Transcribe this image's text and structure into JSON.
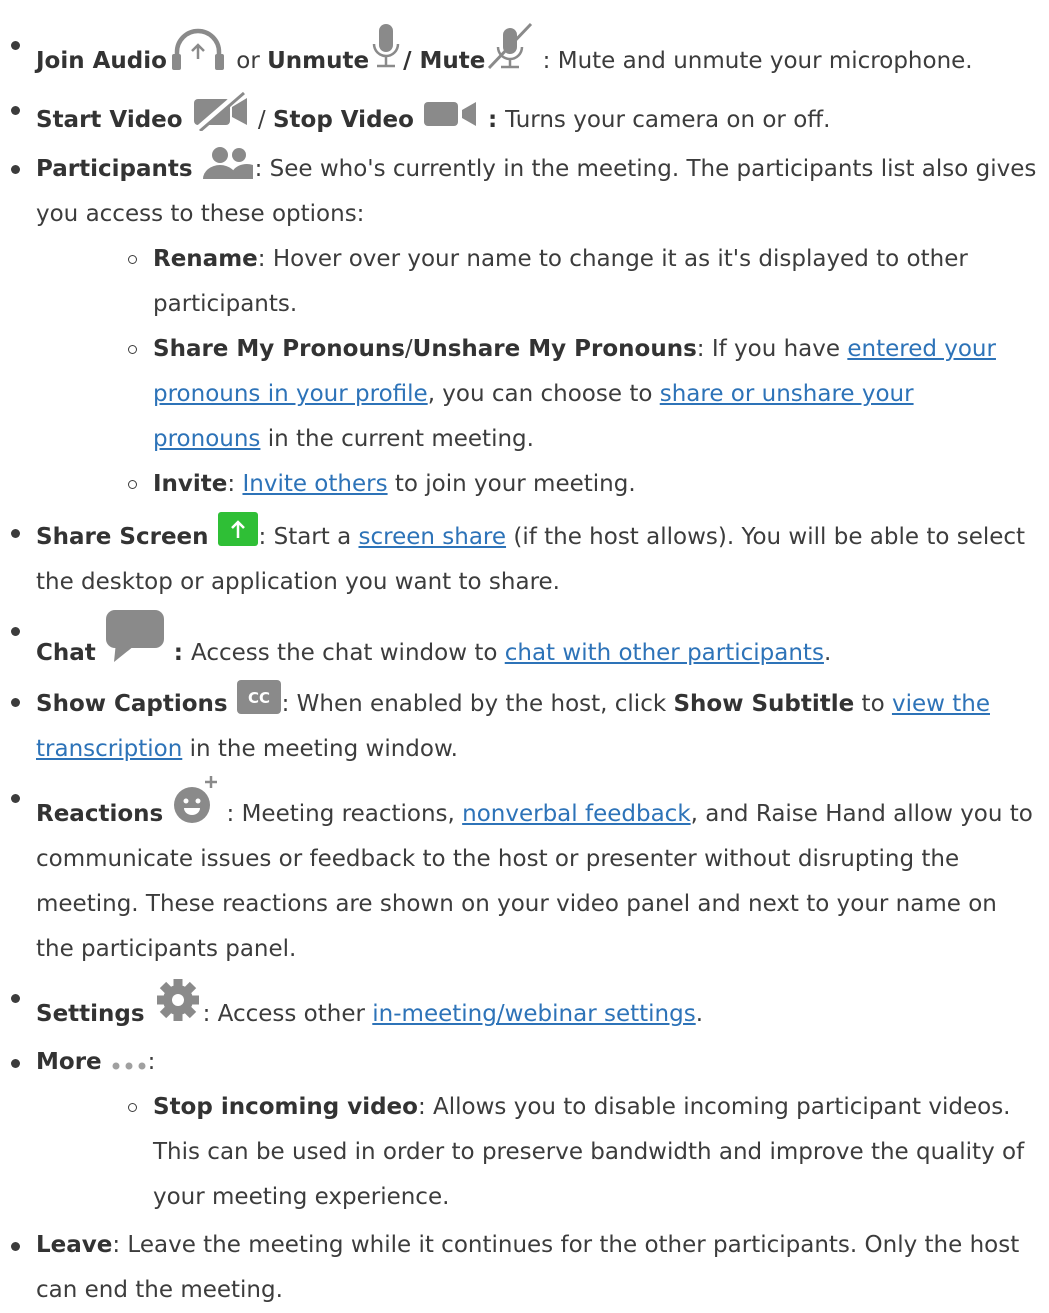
{
  "items": [
    {
      "parts": [
        {
          "t": "b",
          "v": "Join Audio"
        },
        {
          "t": "icon",
          "name": "headphones-arrow-icon"
        },
        {
          "t": "x",
          "v": " or "
        },
        {
          "t": "b",
          "v": "Unmute"
        },
        {
          "t": "icon",
          "name": "microphone-icon"
        },
        {
          "t": "b",
          "v": "/ Mute"
        },
        {
          "t": "icon",
          "name": "microphone-muted-icon"
        },
        {
          "t": "x",
          "v": " : Mute and unmute your microphone."
        }
      ]
    },
    {
      "parts": [
        {
          "t": "b",
          "v": "Start Video "
        },
        {
          "t": "icon",
          "name": "video-off-icon"
        },
        {
          "t": "x",
          "v": " / "
        },
        {
          "t": "b",
          "v": "Stop Video "
        },
        {
          "t": "icon",
          "name": "video-camera-icon"
        },
        {
          "t": "b",
          "v": " : "
        },
        {
          "t": "x",
          "v": "Turns your camera on or off."
        }
      ]
    },
    {
      "parts": [
        {
          "t": "b",
          "v": "Participants "
        },
        {
          "t": "icon",
          "name": "participants-icon"
        },
        {
          "t": "x",
          "v": ": See who's currently in the meeting. The participants list also gives you access to these options:"
        }
      ],
      "sub": [
        {
          "parts": [
            {
              "t": "b",
              "v": "Rename"
            },
            {
              "t": "x",
              "v": ": Hover over your name to change it as it's displayed to other participants."
            }
          ]
        },
        {
          "parts": [
            {
              "t": "b",
              "v": "Share My Pronouns"
            },
            {
              "t": "x",
              "v": "/"
            },
            {
              "t": "b",
              "v": "Unshare My Pronouns"
            },
            {
              "t": "x",
              "v": ": If you have "
            },
            {
              "t": "a",
              "v": "entered your pronouns in your profile"
            },
            {
              "t": "x",
              "v": ", you can choose to "
            },
            {
              "t": "a",
              "v": "share or unshare your pronouns"
            },
            {
              "t": "x",
              "v": " in the current meeting."
            }
          ]
        },
        {
          "parts": [
            {
              "t": "b",
              "v": "Invite"
            },
            {
              "t": "x",
              "v": ": "
            },
            {
              "t": "a",
              "v": "Invite others"
            },
            {
              "t": "x",
              "v": " to join your meeting."
            }
          ]
        }
      ]
    },
    {
      "parts": [
        {
          "t": "b",
          "v": "Share Screen "
        },
        {
          "t": "icon",
          "name": "share-screen-icon"
        },
        {
          "t": "x",
          "v": ": Start a "
        },
        {
          "t": "a",
          "v": "screen share"
        },
        {
          "t": "x",
          "v": " (if the host allows). You will be able to select the desktop or application you want to share."
        }
      ]
    },
    {
      "parts": [
        {
          "t": "b",
          "v": "Chat "
        },
        {
          "t": "icon",
          "name": "chat-bubble-icon"
        },
        {
          "t": "b",
          "v": " : "
        },
        {
          "t": "x",
          "v": "Access the chat window to "
        },
        {
          "t": "a",
          "v": "chat with other participants"
        },
        {
          "t": "x",
          "v": "."
        }
      ]
    },
    {
      "parts": [
        {
          "t": "b",
          "v": "Show Captions "
        },
        {
          "t": "icon",
          "name": "closed-captions-icon",
          "label": "CC"
        },
        {
          "t": "x",
          "v": ": When enabled by the host, click "
        },
        {
          "t": "b",
          "v": "Show Subtitle"
        },
        {
          "t": "x",
          "v": " to "
        },
        {
          "t": "a",
          "v": "view the transcription"
        },
        {
          "t": "x",
          "v": " in the meeting window."
        }
      ]
    },
    {
      "parts": [
        {
          "t": "b",
          "v": "Reactions "
        },
        {
          "t": "icon",
          "name": "reactions-smiley-icon"
        },
        {
          "t": "x",
          "v": " : Meeting reactions, "
        },
        {
          "t": "a",
          "v": "nonverbal feedback"
        },
        {
          "t": "x",
          "v": ", and Raise Hand allow you to communicate issues or feedback to the host or presenter without disrupting the meeting. These reactions are shown on your video panel and next to your name on the participants panel."
        }
      ]
    },
    {
      "parts": [
        {
          "t": "b",
          "v": "Settings "
        },
        {
          "t": "icon",
          "name": "settings-gear-icon"
        },
        {
          "t": "x",
          "v": ": Access other "
        },
        {
          "t": "a",
          "v": "in-meeting/webinar settings"
        },
        {
          "t": "x",
          "v": "."
        }
      ]
    },
    {
      "parts": [
        {
          "t": "b",
          "v": "More "
        },
        {
          "t": "icon",
          "name": "more-dots-icon"
        },
        {
          "t": "x",
          "v": ":"
        }
      ],
      "sub": [
        {
          "parts": [
            {
              "t": "b",
              "v": "Stop incoming video"
            },
            {
              "t": "x",
              "v": ": Allows you to disable incoming participant videos. This can be used in order to preserve bandwidth and improve the quality of your meeting experience."
            }
          ]
        }
      ]
    },
    {
      "parts": [
        {
          "t": "b",
          "v": "Leave"
        },
        {
          "t": "x",
          "v": ": Leave the meeting while it continues for the other participants. Only the host can end the meeting."
        }
      ]
    }
  ]
}
